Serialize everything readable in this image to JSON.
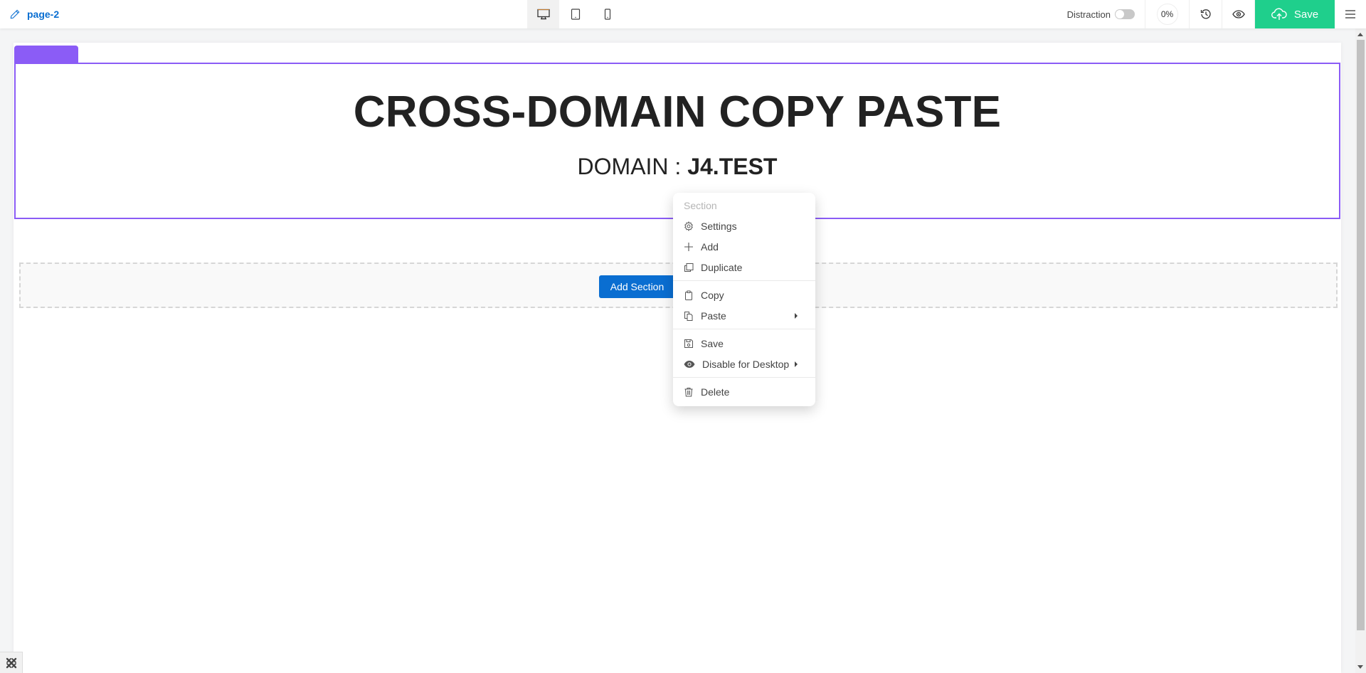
{
  "header": {
    "page_title": "page-2",
    "devices": [
      {
        "name": "desktop",
        "icon": "desktop-icon",
        "active": true
      },
      {
        "name": "tablet",
        "icon": "tablet-icon",
        "active": false
      },
      {
        "name": "mobile",
        "icon": "mobile-icon",
        "active": false
      }
    ],
    "distraction_label": "Distraction",
    "distraction_on": false,
    "progress_label": "0%",
    "save_label": "Save",
    "colors": {
      "save": "#1fcf8c",
      "link": "#0a6ed1",
      "accent": "#8b5cf6"
    }
  },
  "canvas": {
    "heading": "CROSS-DOMAIN COPY PASTE",
    "subheading_prefix": "DOMAIN : ",
    "subheading_value": "J4.TEST",
    "add_section_label": "Add Section"
  },
  "context_menu": {
    "header": "Section",
    "items": [
      {
        "label": "Settings",
        "icon": "gear-icon"
      },
      {
        "label": "Add",
        "icon": "plus-icon"
      },
      {
        "label": "Duplicate",
        "icon": "duplicate-icon"
      },
      {
        "label": "Copy",
        "icon": "clipboard-icon"
      },
      {
        "label": "Paste",
        "icon": "paste-icon",
        "submenu": true
      },
      {
        "label": "Save",
        "icon": "save-icon"
      },
      {
        "label": "Disable for Desktop",
        "icon": "eye-icon",
        "submenu": true
      },
      {
        "label": "Delete",
        "icon": "trash-icon"
      }
    ]
  }
}
